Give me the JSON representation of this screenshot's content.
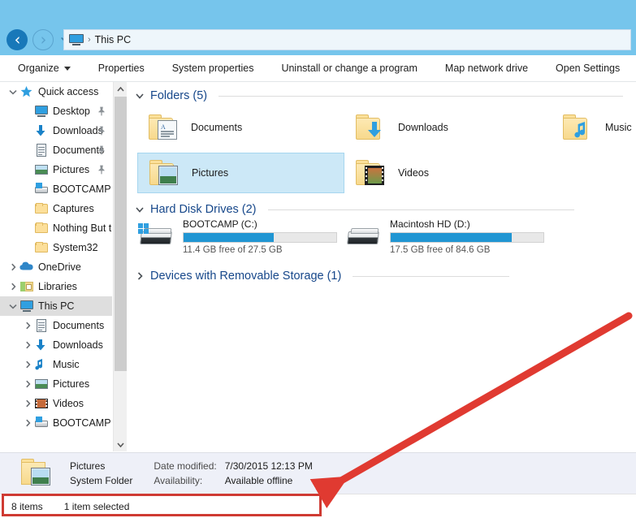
{
  "address": {
    "breadcrumb_root": "This PC",
    "separator": "›",
    "back_tooltip": "Back",
    "forward_tooltip": "Forward",
    "recent_tooltip": "Recent locations"
  },
  "toolbar": {
    "organize": "Organize",
    "properties": "Properties",
    "system_properties": "System properties",
    "uninstall": "Uninstall or change a program",
    "map_drive": "Map network drive",
    "open_settings": "Open Settings"
  },
  "sidebar": {
    "items": [
      {
        "label": "Quick access",
        "icon": "star-icon",
        "indent": 0,
        "chevron": "down",
        "pinned": false,
        "selected": false
      },
      {
        "label": "Desktop",
        "icon": "desktop-icon",
        "indent": 1,
        "chevron": "none",
        "pinned": true,
        "selected": false
      },
      {
        "label": "Downloads",
        "icon": "downloads-icon",
        "indent": 1,
        "chevron": "none",
        "pinned": true,
        "selected": false
      },
      {
        "label": "Documents",
        "icon": "document-icon",
        "indent": 1,
        "chevron": "none",
        "pinned": true,
        "selected": false
      },
      {
        "label": "Pictures",
        "icon": "pictures-icon",
        "indent": 1,
        "chevron": "none",
        "pinned": true,
        "selected": false
      },
      {
        "label": "BOOTCAMP (C:)",
        "icon": "drive-icon",
        "indent": 1,
        "chevron": "none",
        "pinned": false,
        "selected": false
      },
      {
        "label": "Captures",
        "icon": "folder-icon",
        "indent": 1,
        "chevron": "none",
        "pinned": false,
        "selected": false
      },
      {
        "label": "Nothing But the",
        "icon": "folder-icon",
        "indent": 1,
        "chevron": "none",
        "pinned": false,
        "selected": false
      },
      {
        "label": "System32",
        "icon": "folder-icon",
        "indent": 1,
        "chevron": "none",
        "pinned": false,
        "selected": false
      },
      {
        "label": "OneDrive",
        "icon": "cloud-icon",
        "indent": 0,
        "chevron": "right",
        "pinned": false,
        "selected": false
      },
      {
        "label": "Libraries",
        "icon": "libraries-icon",
        "indent": 0,
        "chevron": "right",
        "pinned": false,
        "selected": false
      },
      {
        "label": "This PC",
        "icon": "pc-icon",
        "indent": 0,
        "chevron": "down",
        "pinned": false,
        "selected": true
      },
      {
        "label": "Documents",
        "icon": "document-icon",
        "indent": 1,
        "chevron": "right",
        "pinned": false,
        "selected": false
      },
      {
        "label": "Downloads",
        "icon": "downloads-icon",
        "indent": 1,
        "chevron": "right",
        "pinned": false,
        "selected": false
      },
      {
        "label": "Music",
        "icon": "music-icon",
        "indent": 1,
        "chevron": "right",
        "pinned": false,
        "selected": false
      },
      {
        "label": "Pictures",
        "icon": "pictures-icon",
        "indent": 1,
        "chevron": "right",
        "pinned": false,
        "selected": false
      },
      {
        "label": "Videos",
        "icon": "videos-icon",
        "indent": 1,
        "chevron": "right",
        "pinned": false,
        "selected": false
      },
      {
        "label": "BOOTCAMP (C:)",
        "icon": "drive-icon",
        "indent": 1,
        "chevron": "right",
        "pinned": false,
        "selected": false
      }
    ]
  },
  "content": {
    "groups": [
      {
        "title": "Folders (5)",
        "expanded": true
      },
      {
        "title": "Hard Disk Drives (2)",
        "expanded": true
      },
      {
        "title": "Devices with Removable Storage (1)",
        "expanded": false
      }
    ],
    "folders": [
      {
        "label": "Documents",
        "icon": "folder-documents-icon",
        "selected": false
      },
      {
        "label": "Downloads",
        "icon": "folder-downloads-icon",
        "selected": false
      },
      {
        "label": "Music",
        "icon": "folder-music-icon",
        "selected": false
      },
      {
        "label": "Pictures",
        "icon": "folder-pictures-icon",
        "selected": true
      },
      {
        "label": "Videos",
        "icon": "folder-videos-icon",
        "selected": false
      }
    ],
    "drives": [
      {
        "name": "BOOTCAMP (C:)",
        "free_text": "11.4 GB free of 27.5 GB",
        "used_percent": 59,
        "icon": "windows-drive-icon"
      },
      {
        "name": "Macintosh HD (D:)",
        "free_text": "17.5 GB free of 84.6 GB",
        "used_percent": 79,
        "icon": "hard-drive-icon"
      }
    ]
  },
  "details": {
    "name": "Pictures",
    "type": "System Folder",
    "date_modified_label": "Date modified:",
    "date_modified_value": "7/30/2015 12:13 PM",
    "availability_label": "Availability:",
    "availability_value": "Available offline"
  },
  "status": {
    "item_count": "8 items",
    "selection": "1 item selected"
  },
  "colors": {
    "accent": "#2196d3",
    "title_band": "#76c5ec",
    "selection": "#cce8f7",
    "group_title": "#16478a",
    "annotation_red": "#cf3b33",
    "details_bg": "#eef0f8"
  }
}
